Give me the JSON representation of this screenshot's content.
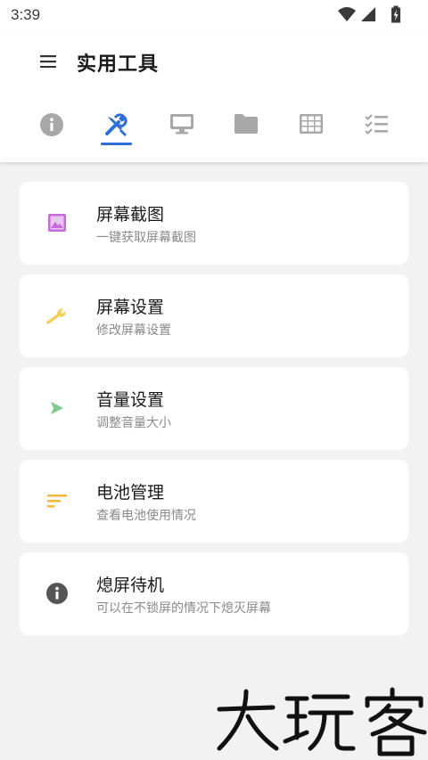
{
  "status_bar": {
    "time": "3:39",
    "icons": [
      "wifi-icon",
      "cell-signal-icon",
      "battery-charging-icon"
    ]
  },
  "header": {
    "title": "实用工具",
    "menu_icon": "menu-icon"
  },
  "tabs": [
    {
      "icon": "info-icon",
      "selected": false
    },
    {
      "icon": "tools-icon",
      "selected": true
    },
    {
      "icon": "monitor-icon",
      "selected": false
    },
    {
      "icon": "folder-icon",
      "selected": false
    },
    {
      "icon": "grid-icon",
      "selected": false
    },
    {
      "icon": "checklist-icon",
      "selected": false
    }
  ],
  "colors": {
    "accent": "#2d6fd6",
    "tab_inactive": "#a8a8a8",
    "screenshot": "#c56ad8",
    "wrench": "#f3cf5a",
    "play": "#7fc98a",
    "sort": "#f5b942",
    "info": "#555555"
  },
  "items": [
    {
      "title": "屏幕截图",
      "subtitle": "一键获取屏幕截图",
      "icon": "image-icon"
    },
    {
      "title": "屏幕设置",
      "subtitle": "修改屏幕设置",
      "icon": "wrench-icon"
    },
    {
      "title": "音量设置",
      "subtitle": "调整音量大小",
      "icon": "play-icon"
    },
    {
      "title": "电池管理",
      "subtitle": "查看电池使用情况",
      "icon": "sort-icon"
    },
    {
      "title": "熄屏待机",
      "subtitle": "可以在不锁屏的情况下熄灭屏幕",
      "icon": "info-circle-icon"
    }
  ],
  "watermark": "大玩客"
}
